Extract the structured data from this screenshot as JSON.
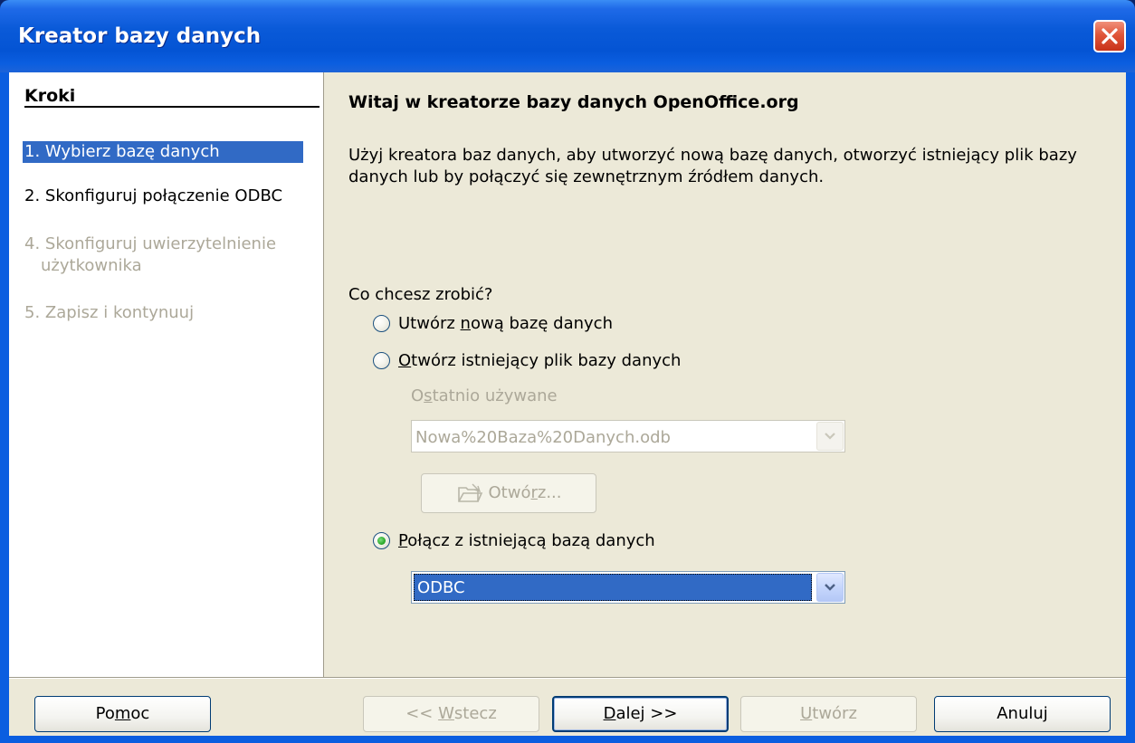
{
  "window": {
    "title": "Kreator bazy danych"
  },
  "steps": {
    "heading": "Kroki",
    "items": [
      {
        "label": "1. Wybierz bazę danych"
      },
      {
        "label": "2. Skonfiguruj połączenie ODBC"
      },
      {
        "label": "4. Skonfiguruj uwierzytelnienie"
      },
      {
        "label": "użytkownika"
      },
      {
        "label": "5. Zapisz i kontynuuj"
      }
    ]
  },
  "content": {
    "title": "Witaj w kreatorze bazy danych OpenOffice.org",
    "description": "Użyj kreatora baz danych, aby utworzyć nową bazę danych, otworzyć istniejący plik bazy danych lub by połączyć się zewnętrznym źródłem danych.",
    "question": "Co chcesz zrobić?",
    "options": [
      {
        "label_pre": "Utwórz ",
        "label_key": "n",
        "label_post": "ową bazę danych",
        "checked": false
      },
      {
        "label_pre": "",
        "label_key": "O",
        "label_post": "twórz istniejący plik bazy danych",
        "checked": false
      },
      {
        "label_pre": "",
        "label_key": "P",
        "label_post": "ołącz z istniejącą bazą danych",
        "checked": true
      }
    ],
    "recent": {
      "label_pre": "O",
      "label_key": "s",
      "label_post": "tatnio używane",
      "value": "Nowa%20Baza%20Danych.odb"
    },
    "open_button": {
      "label_pre": "Otwó",
      "label_key": "r",
      "label_post": "z..."
    },
    "db_type": {
      "value": "ODBC"
    }
  },
  "buttons": {
    "help": {
      "pre": "Po",
      "key": "m",
      "post": "oc"
    },
    "back": {
      "pre": "<< ",
      "key": "W",
      "post": "stecz"
    },
    "next": {
      "pre": "",
      "key": "D",
      "post": "alej >>"
    },
    "create": {
      "pre": "",
      "key": "U",
      "post": "twórz"
    },
    "cancel": {
      "pre": "Anuluj",
      "key": "",
      "post": ""
    }
  }
}
